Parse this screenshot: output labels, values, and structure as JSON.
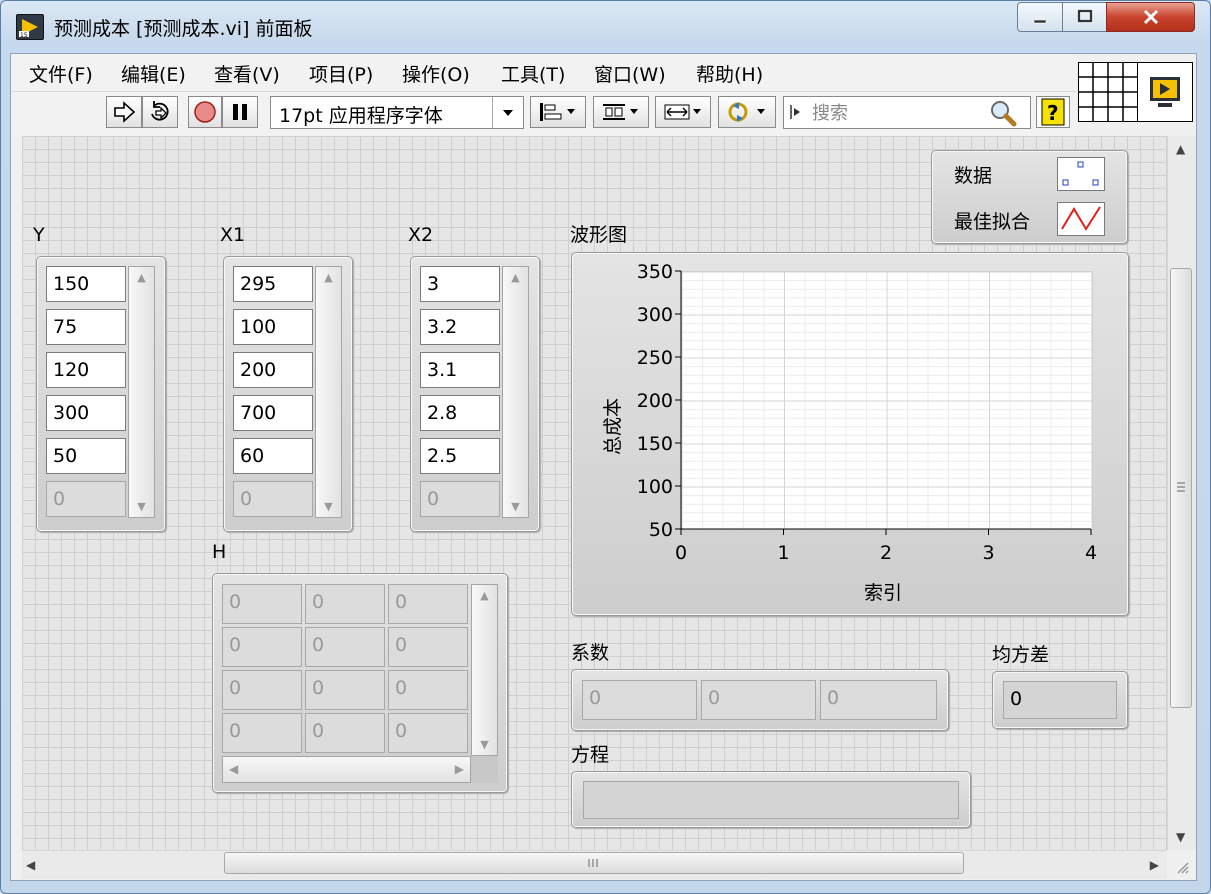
{
  "window": {
    "title": "预测成本 [预测成本.vi] 前面板",
    "minimize_glyph": "minimize-icon",
    "maximize_glyph": "maximize-icon",
    "close_glyph": "close-icon"
  },
  "menubar": {
    "items": [
      {
        "label": "文件(F)"
      },
      {
        "label": "编辑(E)"
      },
      {
        "label": "查看(V)"
      },
      {
        "label": "项目(P)"
      },
      {
        "label": "操作(O)"
      },
      {
        "label": "工具(T)"
      },
      {
        "label": "窗口(W)"
      },
      {
        "label": "帮助(H)"
      }
    ]
  },
  "toolbar": {
    "font": "17pt 应用程序字体",
    "search_placeholder": "搜索",
    "icons": [
      "run-arrow-icon",
      "run-continuously-icon",
      "abort-icon",
      "pause-icon",
      "align-icon",
      "distribute-icon",
      "resize-icon",
      "reorder-icon",
      "search-icon",
      "help-icon"
    ]
  },
  "controls": {
    "Y": {
      "label": "Y",
      "values": [
        "150",
        "75",
        "120",
        "300",
        "50"
      ],
      "empty": "0"
    },
    "X1": {
      "label": "X1",
      "values": [
        "295",
        "100",
        "200",
        "700",
        "60"
      ],
      "empty": "0"
    },
    "X2": {
      "label": "X2",
      "values": [
        "3",
        "3.2",
        "3.1",
        "2.8",
        "2.5"
      ],
      "empty": "0"
    },
    "H": {
      "label": "H",
      "rows": [
        [
          "0",
          "0",
          "0"
        ],
        [
          "0",
          "0",
          "0"
        ],
        [
          "0",
          "0",
          "0"
        ],
        [
          "0",
          "0",
          "0"
        ]
      ]
    },
    "coefficients": {
      "label": "系数",
      "values": [
        "0",
        "0",
        "0"
      ]
    },
    "mse": {
      "label": "均方差",
      "value": "0"
    },
    "equation": {
      "label": "方程",
      "value": ""
    }
  },
  "legend": {
    "items": [
      {
        "name": "数据",
        "style": "points"
      },
      {
        "name": "最佳拟合",
        "style": "line",
        "color": "#e0201a"
      }
    ]
  },
  "chart_data": {
    "type": "line",
    "title": "波形图",
    "xlabel": "索引",
    "ylabel": "总成本",
    "xlim": [
      0,
      4
    ],
    "ylim": [
      50,
      350
    ],
    "x_ticks": [
      "0",
      "1",
      "2",
      "3",
      "4"
    ],
    "y_ticks": [
      "350",
      "300",
      "250",
      "200",
      "150",
      "100",
      "50"
    ],
    "grid": true,
    "series": []
  }
}
